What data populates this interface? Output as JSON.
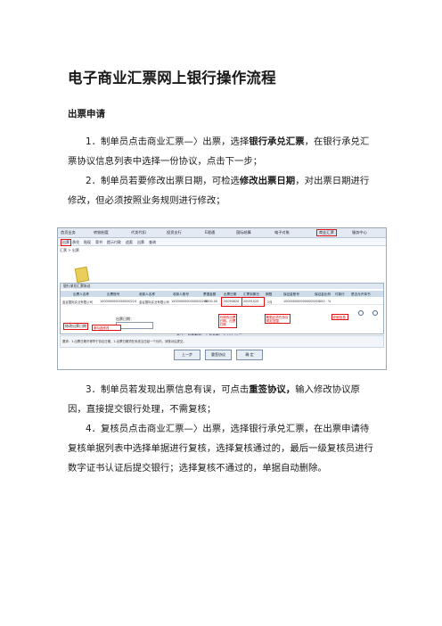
{
  "doc": {
    "title": "电子商业汇票网上银行操作流程",
    "section": "出票申请",
    "p1": {
      "pre": "1．制单员点击商业汇票—〉出票，选择",
      "bold": "银行承兑汇票",
      "post": "，在银行承兑汇票协议信息列表中选择一份协议，点击下一步；"
    },
    "p2": {
      "pre": "2．制单员若要修改出票日期，可检选",
      "bold": "修改出票日期",
      "post": "，对出票日期进行修改，但必须按照业务规则进行修改；"
    },
    "p3": {
      "pre": "3．制单员若发现出票信息有误，可点击",
      "bold": "重签协议，",
      "post": "输入修改协议原因，直接提交银行处理，不需复核；"
    },
    "p4": {
      "pre": "4．复核员点击商业汇票—〉出票，选择银行承兑汇票，在出票申请待复核单据列表中选择单据进行复核，选择复核通过的，最后一级复核员进行数字证书认证后提交银行；选择复核不通过的，单据自动删除。"
    }
  },
  "screenshot": {
    "topnav": [
      "首页业务",
      "转账制度",
      "代发代扣",
      "投资支行",
      "E理通",
      "国际结算",
      "电子对账",
      "商业汇票",
      "服务中心"
    ],
    "subnav": [
      "出票",
      "承兑",
      "贴现",
      "背书",
      "提示付款",
      "追索",
      "出票",
      "查询"
    ],
    "crumb": "汇票 > 出票",
    "panel_title": "银行承兑汇票协议",
    "headers": [
      "出票人名称",
      "出票账号",
      "收款人名称",
      "收款人账号",
      "票据金额",
      "出票日期",
      "汇票到期日",
      "期限",
      "保证金账号",
      "保证金比例",
      "付款行",
      "是否允许背书"
    ],
    "row": [
      "金谷国际实业有限公司",
      "1000000000000000224",
      "金谷国际实业有限公司",
      "1000000000000002260",
      "8000.00",
      "20090820",
      "20091020",
      "2月",
      "1000000000000000000",
      "100",
      "%",
      ""
    ],
    "date_label": "修改出票日期",
    "date_field": "出票日期：",
    "sum_text": "合计：  张票数量：   1   总金额：  8,000.00元",
    "footer_text": "要求：1.出票日期不得早于协议日期，2.出票日期须在系统当日起一个月内，请核对后提交。",
    "buttons": [
      "上一步",
      "重签协议",
      "确 定"
    ],
    "notes": {
      "modify": "可修改出票日期，出票日期",
      "date_rule": "期限必须在协议规定范围",
      "detail": "详细信息",
      "check": "请勾选修改"
    }
  }
}
